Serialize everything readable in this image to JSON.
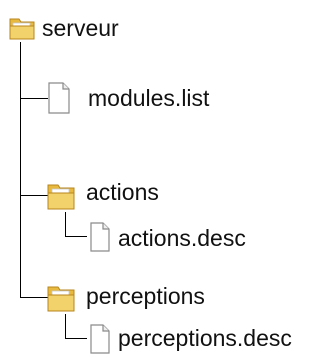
{
  "tree": {
    "root": {
      "label": "serveur",
      "icon": "folder-icon"
    },
    "items": [
      {
        "label": "modules.list",
        "icon": "file-icon"
      },
      {
        "label": "actions",
        "icon": "folder-icon",
        "children": [
          {
            "label": "actions.desc",
            "icon": "file-icon"
          }
        ]
      },
      {
        "label": "perceptions",
        "icon": "folder-icon",
        "children": [
          {
            "label": "perceptions.desc",
            "icon": "file-icon"
          }
        ]
      }
    ]
  },
  "colors": {
    "folder_body": "#f2d36b",
    "folder_tab": "#e8b93f",
    "folder_paper": "#ffffff",
    "file_fill": "#ffffff",
    "file_stroke": "#8a8a8a",
    "connector": "#000000"
  }
}
